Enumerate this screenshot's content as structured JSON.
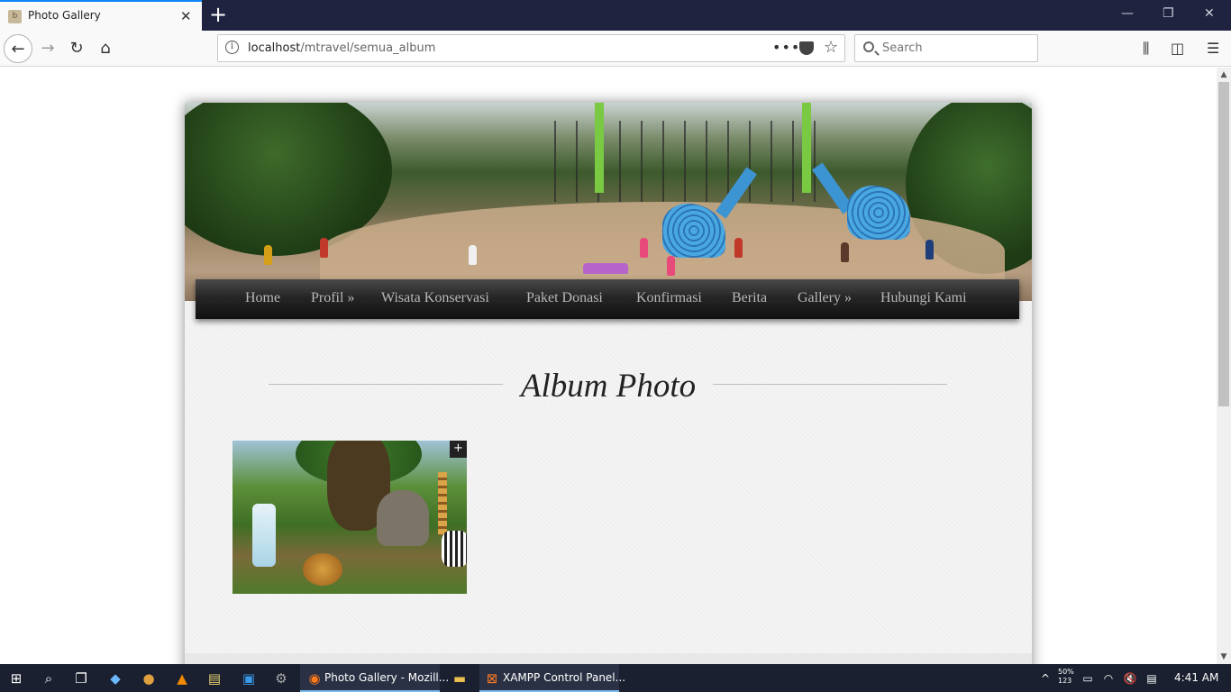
{
  "browser": {
    "tab_title": "Photo Gallery",
    "tab_favicon": "b",
    "url_host": "localhost",
    "url_path": "/mtravel/semua_album",
    "search_placeholder": "Search"
  },
  "site": {
    "menu": [
      {
        "label": "Home"
      },
      {
        "label": "Profil »"
      },
      {
        "label": "Wisata Konservasi"
      },
      {
        "label": "Paket Donasi"
      },
      {
        "label": "Konfirmasi"
      },
      {
        "label": "Berita"
      },
      {
        "label": "Gallery »"
      },
      {
        "label": "Hubungi Kami"
      }
    ],
    "page_title": "Album Photo",
    "album_expand_label": "+"
  },
  "taskbar": {
    "apps": [
      {
        "label": "Photo Gallery - Mozill..."
      },
      {
        "label": "XAMPP Control Panel..."
      }
    ],
    "tray_battery_line1": "50%",
    "tray_battery_line2": "123",
    "time": "4:41 AM"
  },
  "colors": {
    "menu_text": "#b8b8b8",
    "tab_accent": "#0a84ff",
    "titlebar": "#202340",
    "taskbar": "#1b2030"
  }
}
